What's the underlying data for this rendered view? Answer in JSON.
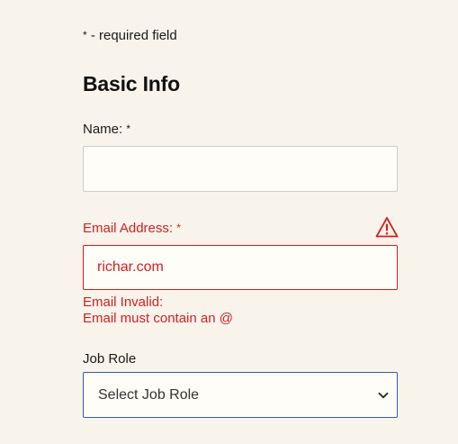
{
  "form": {
    "required_note": {
      "marker": "*",
      "text": "- required field"
    },
    "section_title": "Basic Info",
    "fields": {
      "name": {
        "label": "Name:",
        "required_marker": "*",
        "value": "",
        "placeholder": ""
      },
      "email": {
        "label": "Email Address:",
        "required_marker": "*",
        "value": "richar.com",
        "status": "error",
        "status_icon": "warning-triangle-icon",
        "errors": [
          "Email Invalid:",
          "Email must contain an @"
        ]
      },
      "job_role": {
        "label": "Job Role",
        "selected": "Select Job Role",
        "dropdown_icon": "chevron-down-icon"
      }
    }
  },
  "colors": {
    "background": "#f8f4ec",
    "error": "#d21f1f",
    "focus_border": "#2e5fa8",
    "input_background": "#fffdf8"
  }
}
